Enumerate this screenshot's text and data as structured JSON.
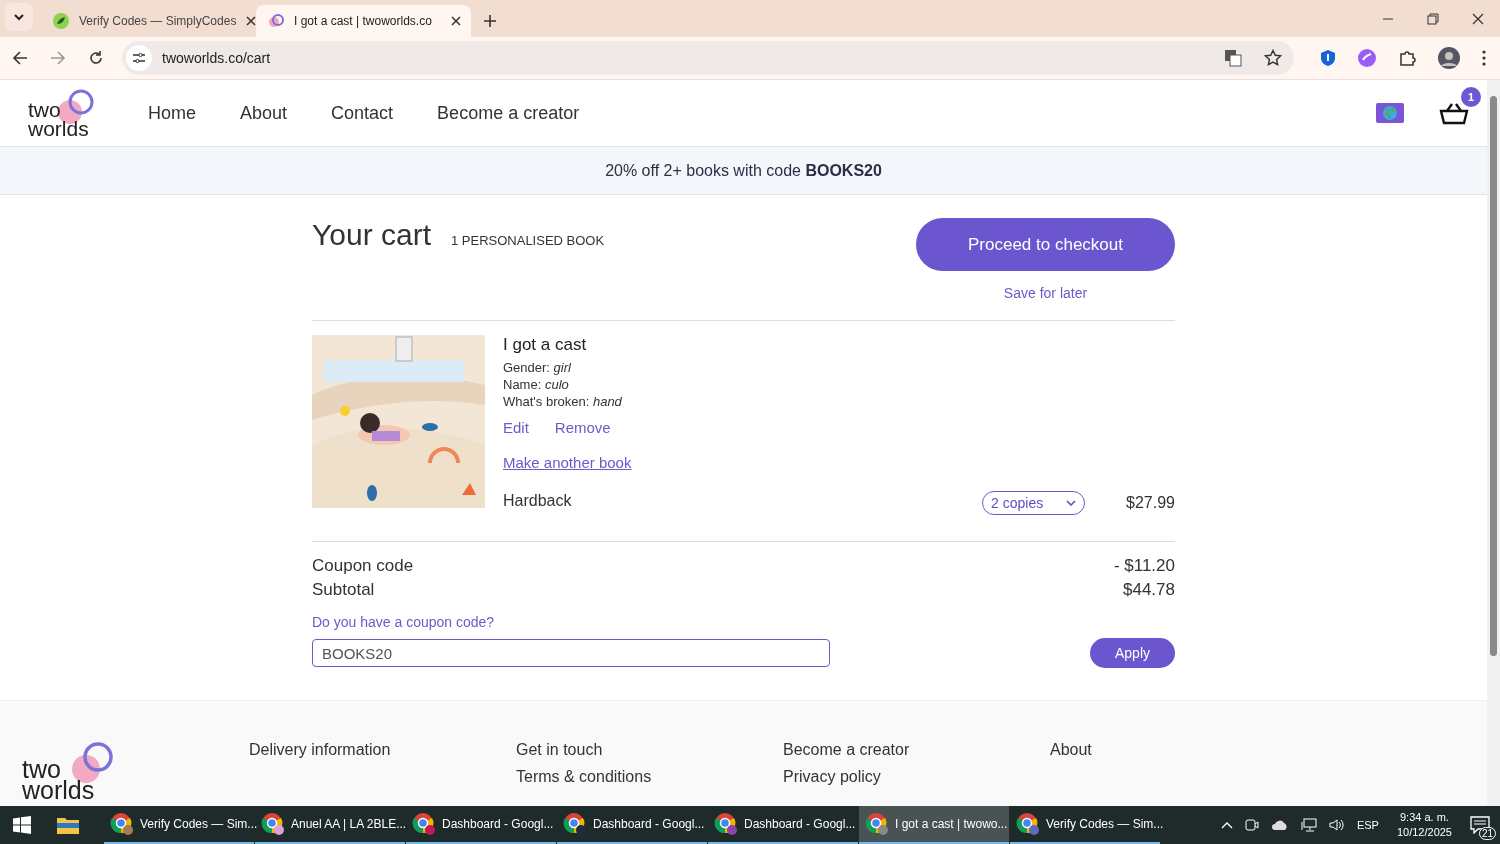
{
  "browser": {
    "tabs": [
      {
        "title": "Verify Codes — SimplyCodes",
        "selected": false
      },
      {
        "title": "I got a cast | twoworlds.co",
        "selected": true
      }
    ],
    "url": "twoworlds.co/cart"
  },
  "site": {
    "logo": [
      "two",
      "worlds"
    ],
    "nav": [
      "Home",
      "About",
      "Contact",
      "Become a creator"
    ],
    "cart_count": "1"
  },
  "promo": "20% off 2+ books with code **BOOKS20**",
  "cart": {
    "title": "Your cart",
    "count": "1 PERSONALISED BOOK",
    "checkout": "Proceed to checkout",
    "save": "Save for later",
    "items": [
      {
        "cover": {
          "kind": "picture"
        },
        "title": "I got a cast",
        "options": [
          "Gender: *girl*",
          "Name: *culo*",
          "What's broken: *hand*"
        ],
        "edit": "Edit",
        "remove": "Remove",
        "make_another": "Make another book",
        "format": "Hardback",
        "quantity": "2 copies",
        "price": "$27.99"
      }
    ],
    "totals": [
      {
        "label": "Coupon code",
        "value": "- $11.20"
      },
      {
        "label": "Subtotal",
        "value": "$44.78"
      }
    ],
    "coupon_prompt": "Do you have a coupon code?",
    "coupon_value": "BOOKS20",
    "apply": "Apply"
  },
  "footer": {
    "logo": [
      "two",
      "worlds"
    ],
    "columns": [
      [
        "Delivery information"
      ],
      [
        "Get in touch",
        "Terms & conditions"
      ],
      [
        "Become a creator",
        "Privacy policy"
      ],
      [
        "About"
      ]
    ]
  },
  "taskbar": {
    "items": [
      {
        "label": "Verify Codes — Sim...",
        "selected": false
      },
      {
        "label": "Anuel AA | LA 2BLE...",
        "selected": false
      },
      {
        "label": "Dashboard - Googl...",
        "selected": false
      },
      {
        "label": "Dashboard - Googl...",
        "selected": false
      },
      {
        "label": "Dashboard - Googl...",
        "selected": false
      },
      {
        "label": "I got a cast | twowo...",
        "selected": true
      },
      {
        "label": "Verify Codes — Sim...",
        "selected": false
      }
    ],
    "language": "ESP",
    "time": "9:34 a. m.",
    "date": "10/12/2025",
    "notifications": "21"
  }
}
